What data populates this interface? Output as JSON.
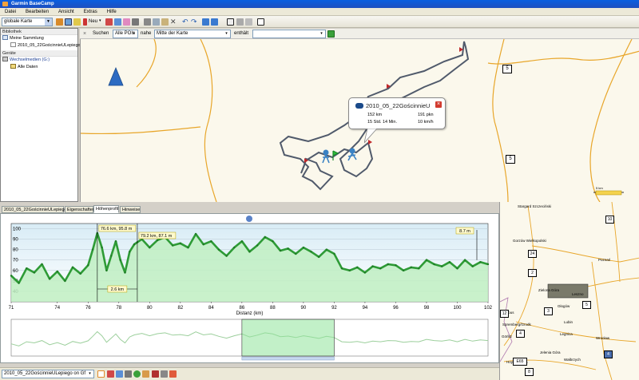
{
  "window": {
    "title": "Garmin BaseCamp"
  },
  "menu": [
    "Datei",
    "Bearbeiten",
    "Ansicht",
    "Extras",
    "Hilfe"
  ],
  "toolbar": {
    "map_select": "globale Karte",
    "new_label": "Neu"
  },
  "library": {
    "header": "Bibliothek",
    "collection": "Meine Sammlung",
    "track_item": "2010_05_22GościnnieULepiego",
    "devices_header": "Geräte",
    "device": "Wechselmedien (G:)",
    "all_data": "Alle Daten"
  },
  "search": {
    "label": "Suchen",
    "type_value": "Alle POIs",
    "near_label": "nahe",
    "near_value": "Mitte der Karte",
    "contains_label": "enthält",
    "contains_value": ""
  },
  "map": {
    "shields": [
      "5",
      "5"
    ],
    "popup": {
      "title": "2010_05_22GościnnieU",
      "distance": "152 km",
      "points": "191 pkn",
      "time": "15 Std. 14 Min.",
      "speed": "10 km/h"
    },
    "scale_label": "5 km"
  },
  "tabs": [
    "2010_05_22GościnnieULepiego",
    "Eigenschaften",
    "Höhenprofil",
    "Hinweise"
  ],
  "active_tab": 2,
  "chart_data": {
    "type": "area",
    "xlabel": "Distanz  (km)",
    "ylabel": "",
    "xlim": [
      71,
      102
    ],
    "ylim": [
      30,
      105
    ],
    "x_ticks": [
      71,
      74,
      76,
      78,
      80,
      82,
      84,
      86,
      88,
      90,
      92,
      94,
      96,
      98,
      100,
      102
    ],
    "y_ticks": [
      40,
      50,
      60,
      70,
      80,
      90,
      100
    ],
    "series": [
      {
        "name": "",
        "x": [
          71,
          71.5,
          72,
          72.5,
          73,
          73.5,
          74,
          74.5,
          75,
          75.5,
          76,
          76.3,
          76.6,
          76.9,
          77.2,
          77.5,
          77.8,
          78.1,
          78.4,
          78.7,
          79,
          79.2,
          79.5,
          80,
          80.5,
          81,
          81.5,
          82,
          82.5,
          83,
          83.5,
          84,
          84.5,
          85,
          85.5,
          86,
          86.5,
          87,
          87.5,
          88,
          88.5,
          89,
          89.5,
          90,
          90.5,
          91,
          91.5,
          92,
          92.5,
          93,
          93.5,
          94,
          94.5,
          95,
          95.5,
          96,
          96.5,
          97,
          97.5,
          98,
          98.5,
          99,
          99.5,
          100,
          100.5,
          101,
          101.5,
          102
        ],
        "y": [
          55,
          48,
          62,
          58,
          66,
          52,
          59,
          50,
          63,
          57,
          65,
          80,
          95.8,
          82,
          60,
          74,
          88,
          70,
          58,
          78,
          85,
          87.1,
          90,
          82,
          89,
          92,
          84,
          86,
          82,
          95,
          85,
          88,
          80,
          74,
          82,
          88,
          78,
          84,
          92,
          88,
          79,
          81,
          76,
          82,
          78,
          73,
          80,
          76,
          62,
          60,
          63,
          58,
          64,
          62,
          66,
          65,
          60,
          63,
          62,
          70,
          66,
          64,
          68,
          62,
          70,
          64,
          68,
          66
        ]
      }
    ],
    "markers": [
      {
        "label": "76.6 km, 95.8 m",
        "x": 76.6
      },
      {
        "label": "79.2 km, 87.1 m",
        "x": 79.2
      }
    ],
    "span_label": "2.6 km",
    "height_label": "8.7 m",
    "selection_range": [
      86,
      92
    ]
  },
  "minimap": {
    "places": [
      "Stargard Szczeciński",
      "Gorzów Wielkopolski",
      "Poznań",
      "Zielona Góra",
      "Głogów",
      "Leszno",
      "Lubin",
      "Legnica",
      "Wrocław",
      "Jelenia Góra",
      "Wałbrzych",
      "Görlitz",
      "Spremberg/Grodk",
      "Cottbus",
      "Hoyerswerda"
    ],
    "shields": [
      "10",
      "24",
      "2",
      "3",
      "5",
      "12",
      "4",
      "4",
      "E65",
      "8"
    ]
  },
  "status": {
    "select_value": "2010_05_22GościnnieULepiego on Gf"
  },
  "colors": {
    "track": "#505a6b",
    "profile_line": "#2e9b36",
    "profile_fill": "#bfeec2",
    "road": "#e8a62a"
  }
}
